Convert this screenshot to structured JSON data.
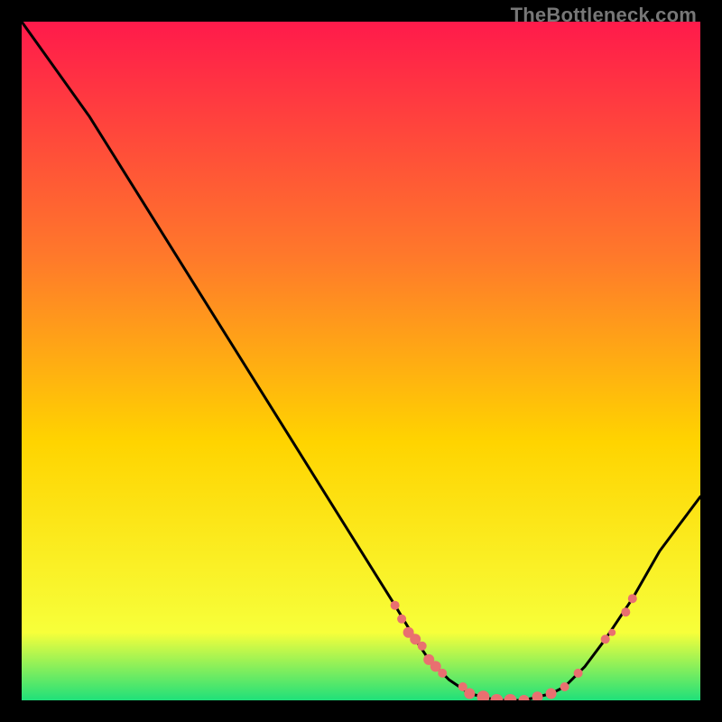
{
  "watermark": "TheBottleneck.com",
  "colors": {
    "gradient_top": "#ff1a4b",
    "gradient_mid1": "#ff7a2a",
    "gradient_mid2": "#ffd400",
    "gradient_mid3": "#f7ff3a",
    "gradient_bottom": "#1fe07a",
    "curve": "#000000",
    "marker": "#e97070",
    "frame_bg": "#000000"
  },
  "chart_data": {
    "type": "line",
    "title": "",
    "xlabel": "",
    "ylabel": "",
    "xlim": [
      0,
      100
    ],
    "ylim": [
      0,
      100
    ],
    "series": [
      {
        "name": "curve",
        "x": [
          0,
          5,
          10,
          15,
          20,
          25,
          30,
          35,
          40,
          45,
          50,
          55,
          58,
          60,
          63,
          66,
          70,
          74,
          78,
          80,
          83,
          86,
          90,
          94,
          97,
          100
        ],
        "y": [
          100,
          93,
          86,
          78,
          70,
          62,
          54,
          46,
          38,
          30,
          22,
          14,
          9,
          6,
          3,
          1,
          0,
          0,
          1,
          2,
          5,
          9,
          15,
          22,
          26,
          30
        ]
      }
    ],
    "markers": [
      {
        "x": 55,
        "y": 14,
        "r": 5
      },
      {
        "x": 56,
        "y": 12,
        "r": 5
      },
      {
        "x": 57,
        "y": 10,
        "r": 6
      },
      {
        "x": 58,
        "y": 9,
        "r": 6
      },
      {
        "x": 59,
        "y": 8,
        "r": 5
      },
      {
        "x": 60,
        "y": 6,
        "r": 6
      },
      {
        "x": 61,
        "y": 5,
        "r": 6
      },
      {
        "x": 62,
        "y": 4,
        "r": 5
      },
      {
        "x": 65,
        "y": 2,
        "r": 5
      },
      {
        "x": 66,
        "y": 1,
        "r": 6
      },
      {
        "x": 68,
        "y": 0.5,
        "r": 7
      },
      {
        "x": 70,
        "y": 0,
        "r": 7
      },
      {
        "x": 72,
        "y": 0,
        "r": 7
      },
      {
        "x": 74,
        "y": 0,
        "r": 6
      },
      {
        "x": 76,
        "y": 0.5,
        "r": 6
      },
      {
        "x": 78,
        "y": 1,
        "r": 6
      },
      {
        "x": 80,
        "y": 2,
        "r": 5
      },
      {
        "x": 82,
        "y": 4,
        "r": 5
      },
      {
        "x": 86,
        "y": 9,
        "r": 5
      },
      {
        "x": 87,
        "y": 10,
        "r": 4
      },
      {
        "x": 89,
        "y": 13,
        "r": 5
      },
      {
        "x": 90,
        "y": 15,
        "r": 5
      }
    ],
    "gradient_stops": [
      {
        "offset": 0.0,
        "color_key": "gradient_top"
      },
      {
        "offset": 0.35,
        "color_key": "gradient_mid1"
      },
      {
        "offset": 0.62,
        "color_key": "gradient_mid2"
      },
      {
        "offset": 0.9,
        "color_key": "gradient_mid3"
      },
      {
        "offset": 1.0,
        "color_key": "gradient_bottom"
      }
    ]
  }
}
